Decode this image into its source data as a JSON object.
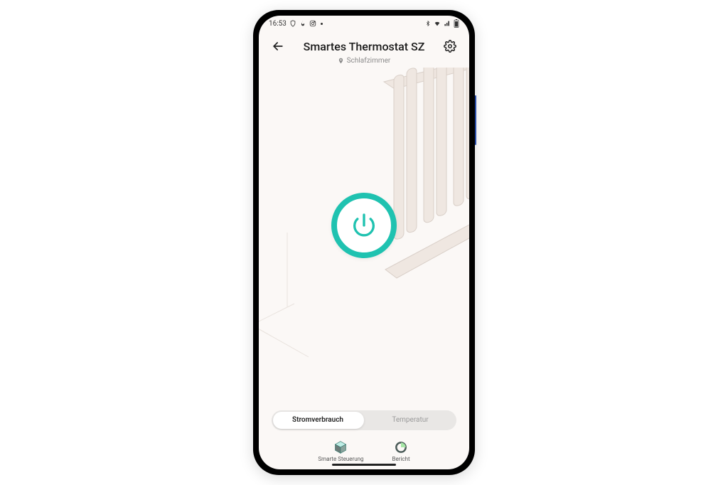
{
  "statusbar": {
    "time": "16:53"
  },
  "header": {
    "title": "Smartes Thermostat SZ",
    "room": "Schlafzimmer"
  },
  "segment": {
    "items": [
      "Stromverbrauch",
      "Temperatur"
    ],
    "active_index": 0
  },
  "tabs": {
    "items": [
      {
        "label": "Smarte Steuerung"
      },
      {
        "label": "Bericht"
      }
    ]
  },
  "colors": {
    "accent": "#1fc2b0"
  }
}
